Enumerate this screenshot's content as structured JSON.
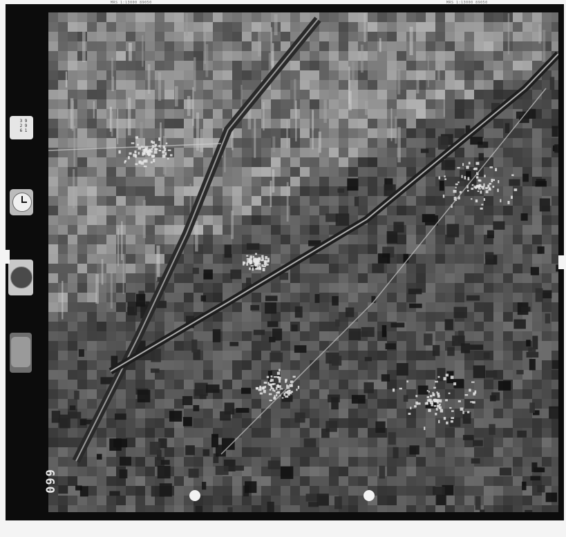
{
  "image": {
    "subject": "aerial-photograph",
    "colors": {
      "film_border": "#0c0c0c",
      "paper": "#f4f4f4"
    }
  },
  "top_labels": [
    "MRS 1:13000 89050",
    "MRS 1:13000 89050"
  ],
  "frame_number": "099"
}
